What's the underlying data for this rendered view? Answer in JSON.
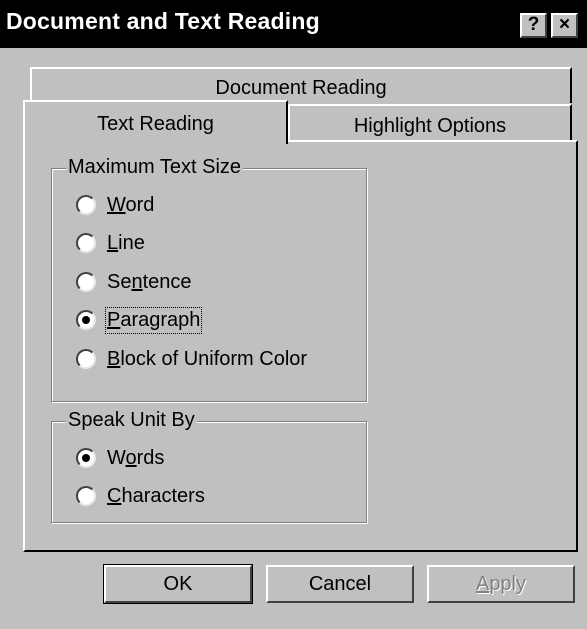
{
  "window": {
    "title": "Document and Text Reading",
    "help_glyph": "?",
    "close_glyph": "×"
  },
  "tabs": [
    {
      "label": "Document Reading",
      "selected": false
    },
    {
      "label": "Text Reading",
      "selected": true
    },
    {
      "label": "Highlight Options",
      "selected": false
    }
  ],
  "max_text_size": {
    "legend": "Maximum Text Size",
    "options": [
      {
        "pre": "",
        "key": "W",
        "post": "ord",
        "checked": false
      },
      {
        "pre": "",
        "key": "L",
        "post": "ine",
        "checked": false
      },
      {
        "pre": "Se",
        "key": "n",
        "post": "tence",
        "checked": false
      },
      {
        "pre": "",
        "key": "P",
        "post": "aragraph",
        "checked": true
      },
      {
        "pre": "",
        "key": "B",
        "post": "lock of Uniform Color",
        "checked": false
      }
    ]
  },
  "speak_unit": {
    "legend": "Speak Unit By",
    "options": [
      {
        "pre": "W",
        "key": "o",
        "post": "rds",
        "checked": true
      },
      {
        "pre": "",
        "key": "C",
        "post": "haracters",
        "checked": false
      }
    ]
  },
  "buttons": {
    "ok": "OK",
    "cancel": "Cancel",
    "apply_key": "A",
    "apply_rest": "pply",
    "apply_enabled": false
  }
}
